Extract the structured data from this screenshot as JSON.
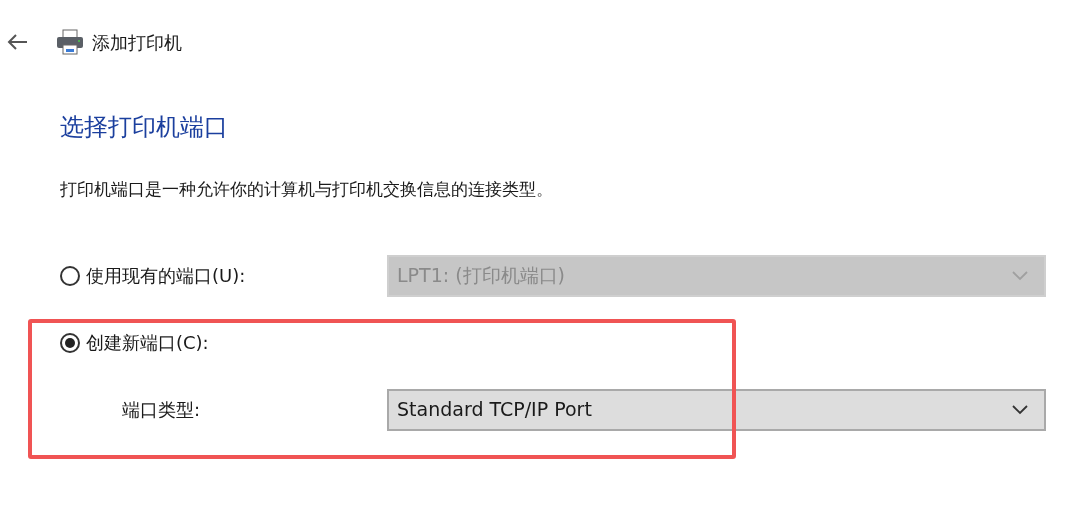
{
  "header": {
    "title": "添加打印机"
  },
  "heading": "选择打印机端口",
  "description": "打印机端口是一种允许你的计算机与打印机交换信息的连接类型。",
  "port_options": [
    {
      "kind": "radio",
      "label": "使用现有的端口(U):",
      "selected": false,
      "dropdown": {
        "value": "LPT1: (打印机端口)",
        "disabled": true
      }
    },
    {
      "kind": "radio",
      "label": "创建新端口(C):",
      "selected": true
    },
    {
      "kind": "field",
      "label": "端口类型:",
      "dropdown": {
        "value": "Standard TCP/IP Port",
        "disabled": false
      }
    }
  ],
  "highlight_box": true
}
